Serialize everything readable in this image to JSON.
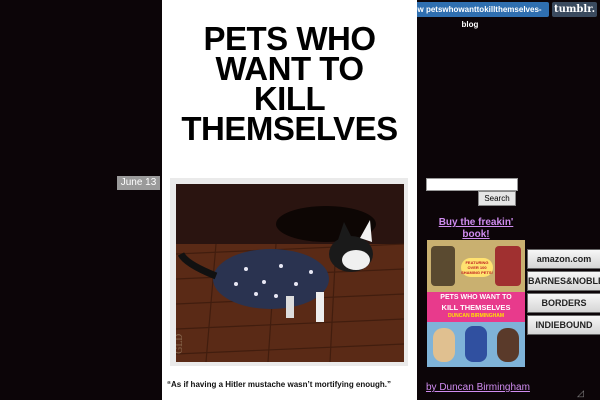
{
  "topbar": {
    "follow_label": "Follow petswhowanttokillthemselves-blog",
    "tumblr_label": "tumblr."
  },
  "blog": {
    "title_lines": [
      "PETS WHO",
      "WANT TO",
      "KILL",
      "THEMSELVES"
    ]
  },
  "post": {
    "date": "June 13",
    "caption": "“As if having a Hitler mustache wasn’t mortifying enough.”",
    "photo_icon": "cat-in-sweater-photo"
  },
  "sidebar": {
    "search_placeholder": "",
    "search_button": "Search",
    "buy_link": "Buy the freakin' book!",
    "book": {
      "top_text": "FEATURING OVER 100 SHAMING PETS!",
      "title_lines": [
        "PETS WHO WANT TO",
        "KILL THEMSELVES"
      ],
      "author": "DUNCAN BIRMINGHAM"
    },
    "stores": [
      "amazon.com",
      "BARNES&NOBLE",
      "BORDERS",
      "INDIEBOUND"
    ],
    "by_line": "by Duncan Birmingham"
  },
  "colors": {
    "background": "#0c0508",
    "link": "#d08cf0",
    "follow": "#2f6fb0"
  }
}
